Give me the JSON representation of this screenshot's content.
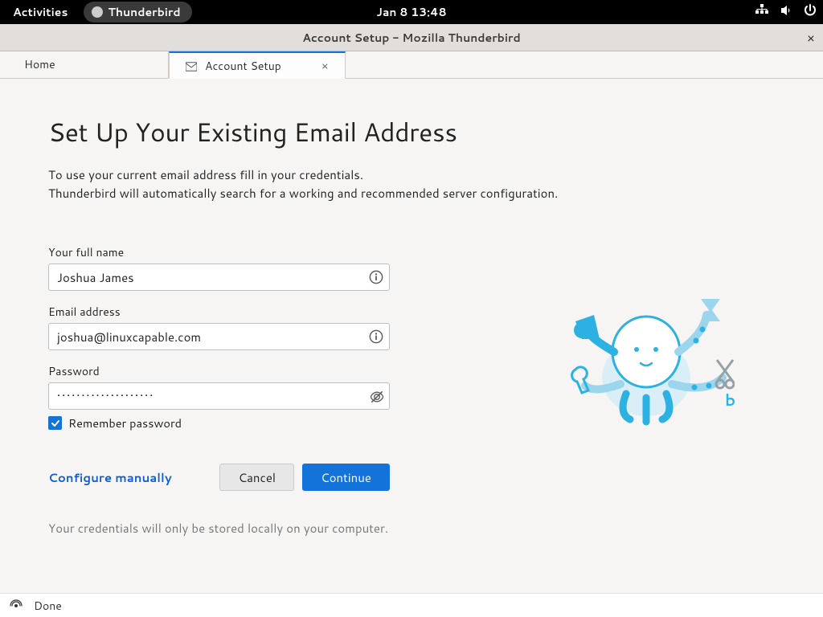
{
  "gnome": {
    "activities": "Activities",
    "app_name": "Thunderbird",
    "clock": "Jan 8  13:48"
  },
  "window": {
    "title": "Account Setup - Mozilla Thunderbird"
  },
  "tabs": {
    "home": "Home",
    "active": "Account Setup"
  },
  "page": {
    "heading": "Set Up Your Existing Email Address",
    "intro_line1": "To use your current email address fill in your credentials.",
    "intro_line2": "Thunderbird will automatically search for a working and recommended server configuration."
  },
  "form": {
    "name_label": "Your full name",
    "name_value": "Joshua James",
    "email_label": "Email address",
    "email_value": "joshua@linuxcapable.com",
    "password_label": "Password",
    "password_value": "••••••••••••••••••••",
    "remember_label": "Remember password"
  },
  "buttons": {
    "configure": "Configure manually",
    "cancel": "Cancel",
    "continue": "Continue"
  },
  "footnote": "Your credentials will only be stored locally on your computer.",
  "status": {
    "done": "Done"
  }
}
